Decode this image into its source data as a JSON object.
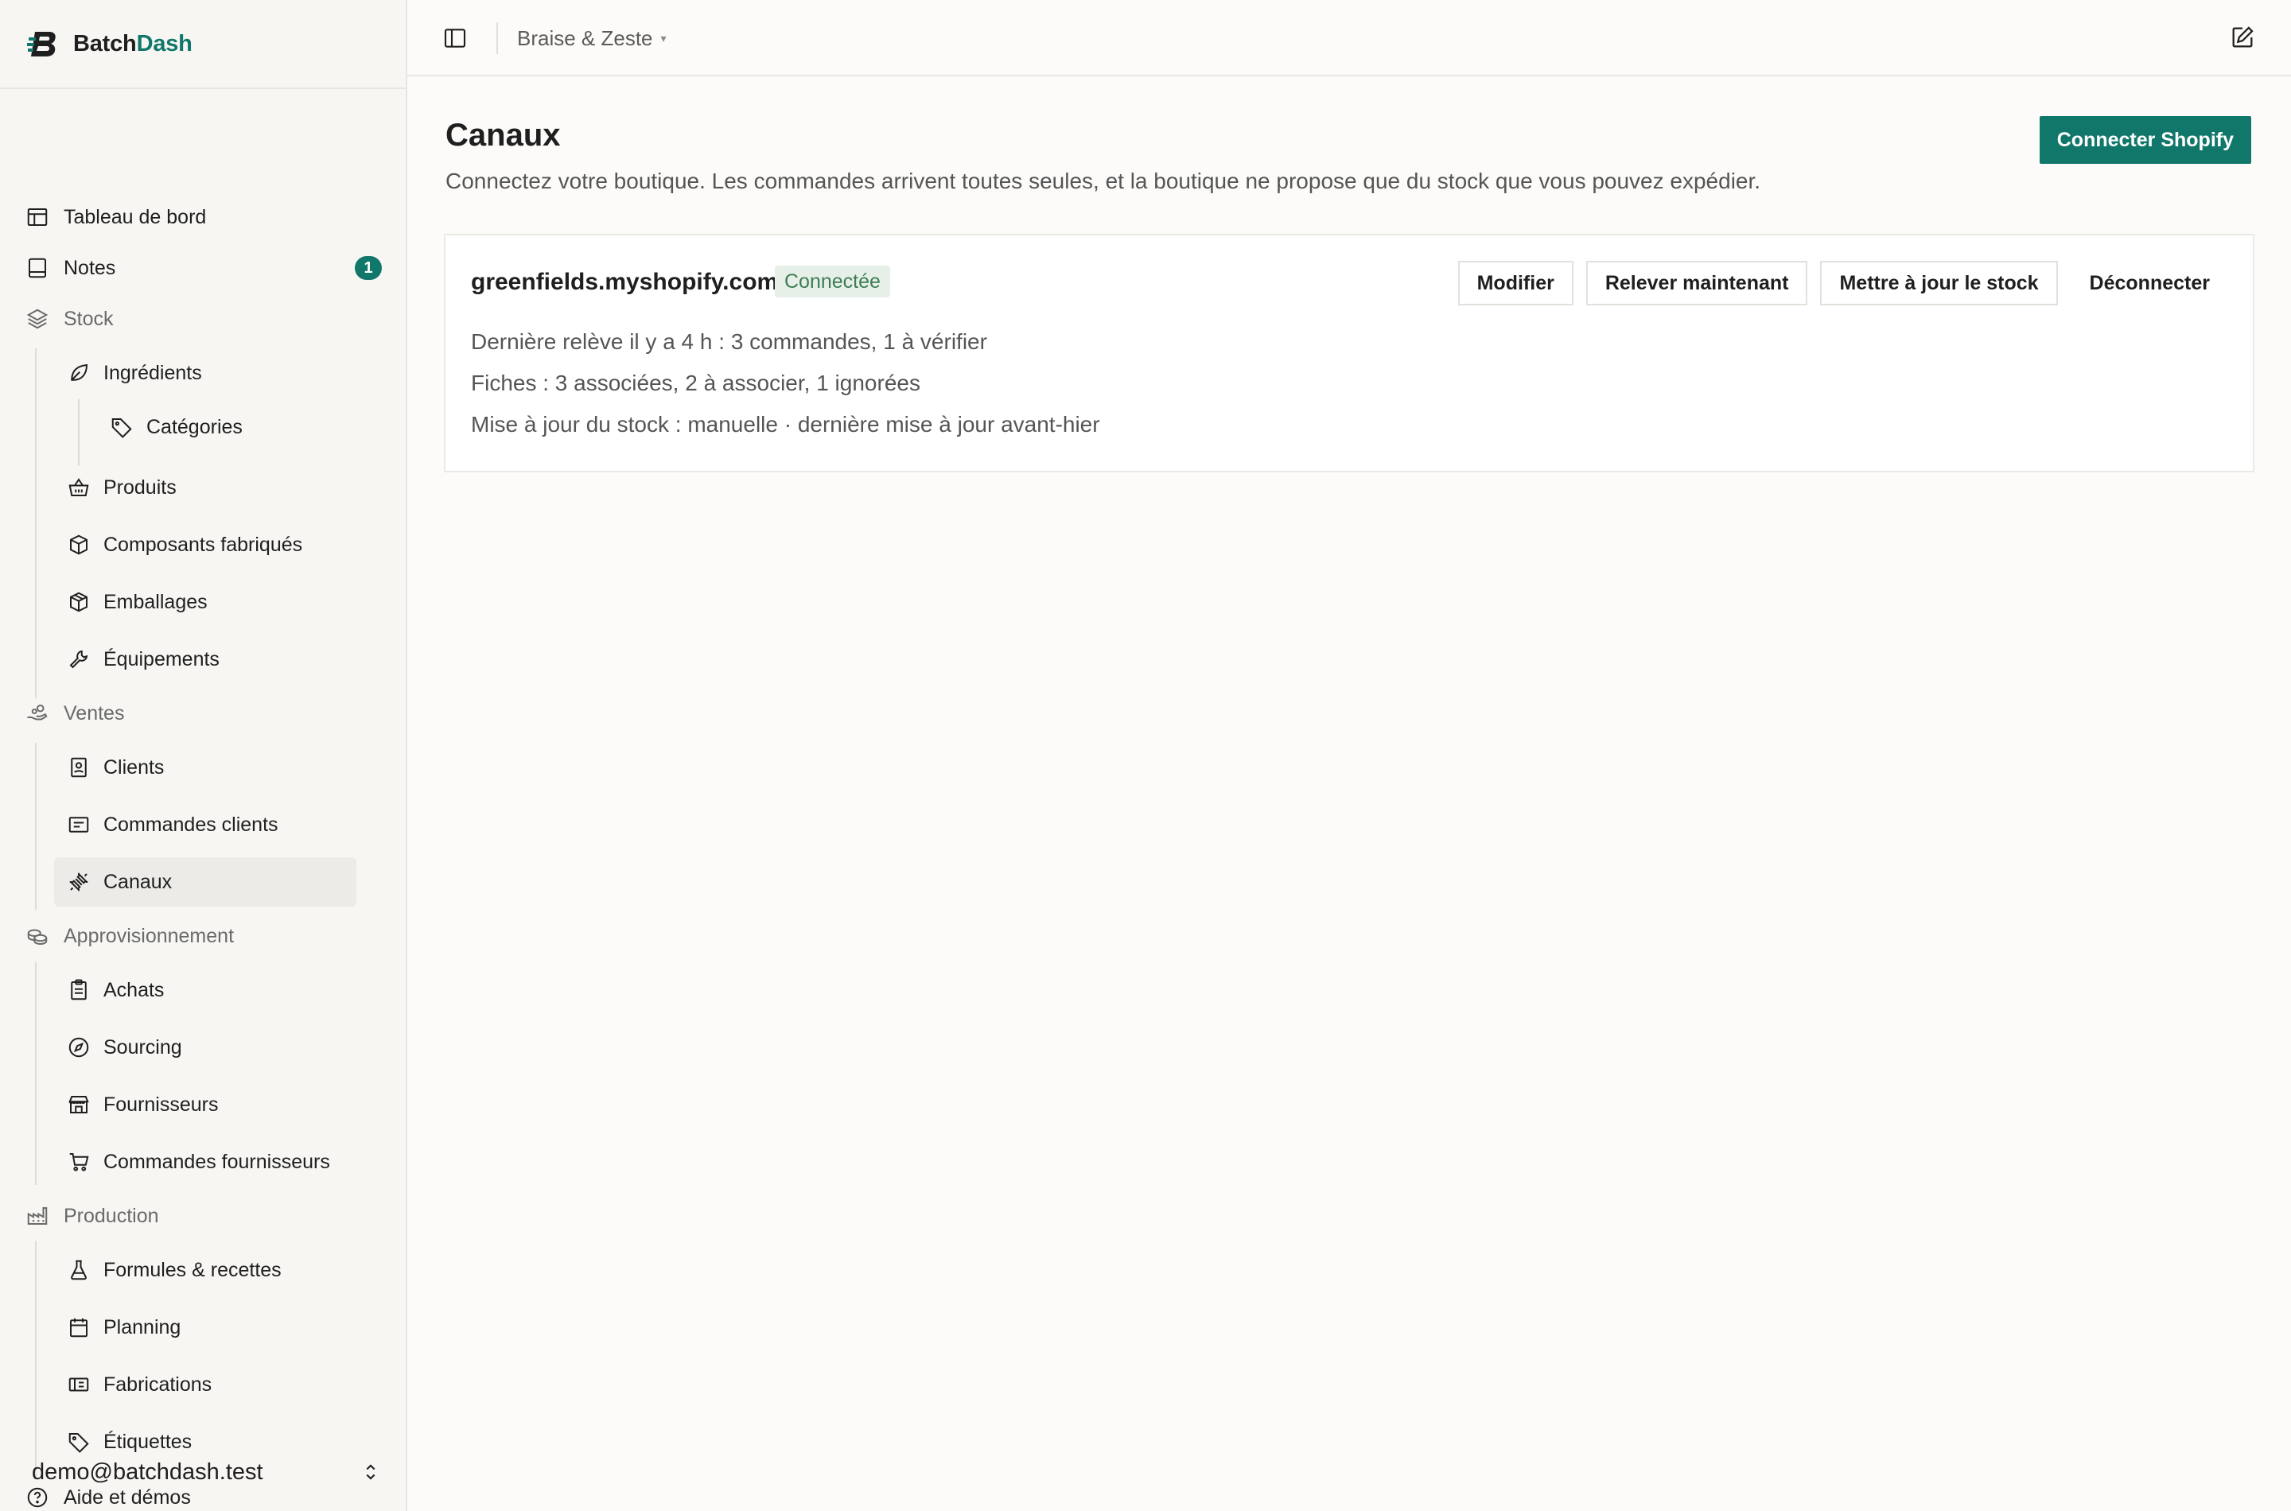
{
  "brand": {
    "name_primary": "Batch",
    "name_accent": "Dash"
  },
  "sidebar": {
    "dashboard": "Tableau de bord",
    "notes": "Notes",
    "notes_badge": "1",
    "stock": "Stock",
    "ingredients": "Ingrédients",
    "categories": "Catégories",
    "products": "Produits",
    "components": "Composants fabriqués",
    "packaging": "Emballages",
    "equipment": "Équipements",
    "sales": "Ventes",
    "clients": "Clients",
    "client_orders": "Commandes clients",
    "channels": "Canaux",
    "procurement": "Approvisionnement",
    "purchases": "Achats",
    "sourcing": "Sourcing",
    "suppliers": "Fournisseurs",
    "supplier_orders": "Commandes fournisseurs",
    "production": "Production",
    "recipes": "Formules & recettes",
    "planning": "Planning",
    "batches": "Fabrications",
    "labels": "Étiquettes",
    "help": "Aide et démos",
    "user_email": "demo@batchdash.test"
  },
  "topbar": {
    "workspace": "Braise & Zeste",
    "caret": "▾"
  },
  "main": {
    "title": "Canaux",
    "subtitle": "Connectez votre boutique. Les commandes arrivent toutes seules, et la boutique ne propose que du stock que vous pouvez expédier.",
    "connect_button": "Connecter Shopify",
    "store": {
      "name": "greenfields.myshopify.com",
      "status": "Connectée",
      "actions": {
        "edit": "Modifier",
        "fetch_now": "Relever maintenant",
        "update_stock": "Mettre à jour le stock",
        "disconnect": "Déconnecter"
      },
      "last_fetch": "Dernière relève il y a 4 h : 3 commandes, 1 à vérifier",
      "listings": "Fiches : 3 associées, 2 à associer, 1 ignorées",
      "stock_update": "Mise à jour du stock : manuelle · dernière mise à jour avant-hier"
    }
  },
  "colors": {
    "accent": "#11776b",
    "status_bg": "#e7efe9",
    "status_text": "#3d7d55",
    "active_bg": "#ecebe7"
  }
}
